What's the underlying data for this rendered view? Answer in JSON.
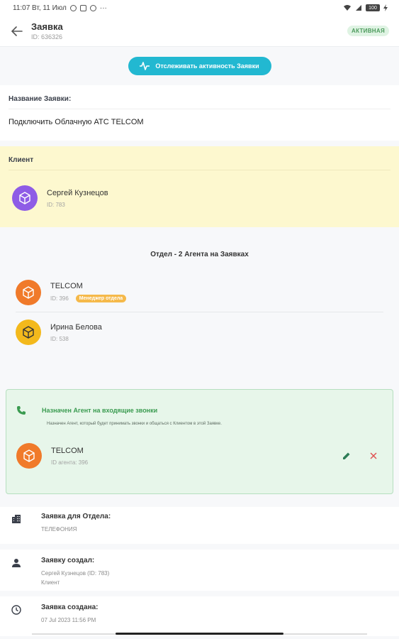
{
  "status_bar": {
    "time_date": "11:07 Вт, 11 Июл",
    "more": "···",
    "battery": "100"
  },
  "header": {
    "title": "Заявка",
    "id": "ID: 636326",
    "status_badge": "АКТИВНАЯ"
  },
  "track_button": {
    "label": "Отслеживать активность Заявки"
  },
  "request_name": {
    "label": "Название Заявки:",
    "value": "Подключить Облачную АТС TELCOM"
  },
  "client": {
    "label": "Клиент",
    "name": "Сергей Кузнецов",
    "id": "ID: 783",
    "avatar_color": "#8e5ce6"
  },
  "department": {
    "title": "Отдел - 2 Агента на Заявках",
    "agents": [
      {
        "name": "TELCOM",
        "id": "ID: 396",
        "badge": "Менеджер отдела",
        "avatar_color": "#f07a2a"
      },
      {
        "name": "Ирина Белова",
        "id": "ID: 538",
        "avatar_color": "#f3b91c"
      }
    ]
  },
  "assigned_agent": {
    "title": "Назначен Агент на входящие звонки",
    "description": "Назначен Агент, который будет принимать звонки и общаться с Клиентом в этой Заявке.",
    "name": "TELCOM",
    "id": "ID агента: 396",
    "avatar_color": "#f07a2a",
    "accent": "#3a9b50"
  },
  "info": {
    "department": {
      "label": "Заявка для Отдела:",
      "value": "ТЕЛЕФОНИЯ"
    },
    "created_by": {
      "label": "Заявку создал:",
      "value": "Сергей Кузнецов (ID: 783)",
      "role": "Клиент"
    },
    "created_at": {
      "label": "Заявка создана:",
      "value": "07 Jul 2023 11:56 PM"
    }
  },
  "colors": {
    "primary": "#22b8d1",
    "client_bg": "#fdf8cf",
    "assigned_bg": "#e7f6ea",
    "delete": "#e05252",
    "edit": "#2e7d57"
  },
  "icons": [
    "back-arrow-icon",
    "activity-icon",
    "cube-icon",
    "phone-icon",
    "pencil-icon",
    "close-icon",
    "building-icon",
    "person-icon",
    "clock-icon"
  ]
}
